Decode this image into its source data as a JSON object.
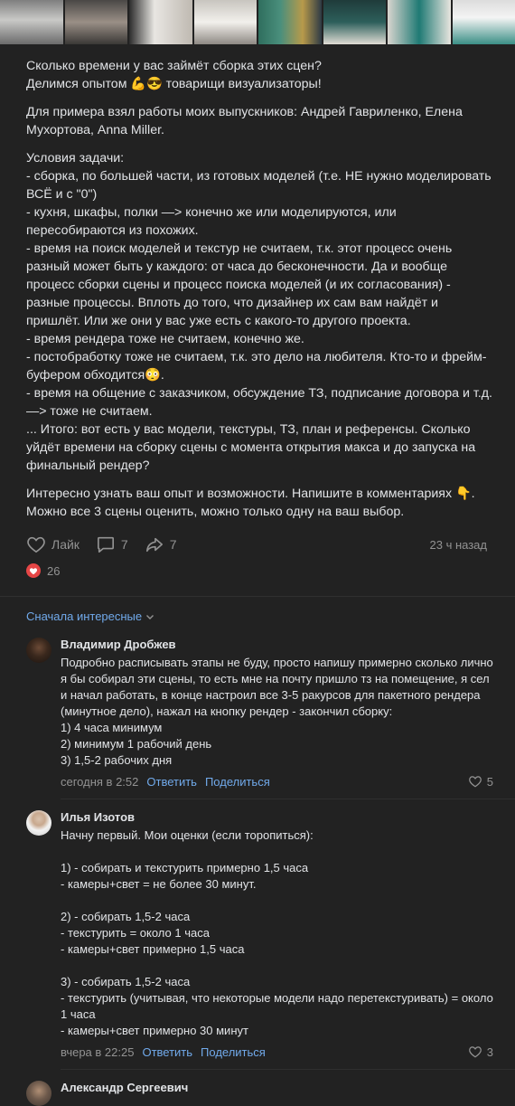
{
  "post": {
    "paragraphs": [
      "Сколько времени у вас займёт сборка этих сцен?\nДелимся опытом 💪😎 товарищи визуализаторы!",
      "Для примера взял работы моих выпускников: Андрей Гавриленко, Елена Мухортова, Anna Miller.",
      "Условия задачи:\n- сборка, по большей части, из готовых моделей (т.е. НЕ нужно моделировать ВСЁ и с \"0\")\n- кухня, шкафы, полки —> конечно же или моделируются, или пересобираются из похожих.\n- время на поиск моделей и текстур не считаем, т.к. этот процесс очень разный может быть у каждого: от часа до бесконечности. Да и вообще процесс сборки сцены и процесс поиска моделей (и их согласования) - разные процессы. Вплоть до того, что дизайнер их сам вам найдёт и пришлёт. Или же они у вас уже есть с какого-то другого проекта.\n- время рендера тоже не считаем, конечно же.\n- постобработку тоже не считаем, т.к. это дело на любителя. Кто-то и фрейм-буфером обходится😳.\n- время на общение с заказчиком, обсуждение ТЗ, подписание договора и т.д. —> тоже не считаем.\n... Итого: вот есть у вас модели, текстуры, ТЗ, план и референсы. Сколько уйдёт времени на сборку сцены с момента открытия макса и до запуска на финальный рендер?",
      "Интересно узнать ваш опыт и возможности. Напишите в комментариях 👇.\nМожно все 3 сцены оценить, можно только одну на ваш выбор."
    ],
    "like_label": "Лайк",
    "comments_count": "7",
    "shares_count": "7",
    "time": "23 ч назад",
    "likes_count": "26"
  },
  "sort_label": "Сначала интересные",
  "comments": [
    {
      "name": "Владимир Дробжев",
      "text": "Подробно расписывать этапы не буду, просто напишу примерно сколько лично я бы собирал эти сцены, то есть мне на почту пришло тз на помещение, я сел и начал работать, в конце настроил все 3-5 ракурсов для пакетного рендера (минутное дело), нажал на кнопку рендер - закончил сборку:\n1) 4 часа минимум\n2) минимум 1 рабочий день\n3) 1,5-2 рабочих дня",
      "time": "сегодня в 2:52",
      "reply": "Ответить",
      "share": "Поделиться",
      "likes": "5"
    },
    {
      "name": "Илья Изотов",
      "text": "Начну первый. Мои оценки (если торопиться):\n\n1) - собирать и текстурить примерно 1,5 часа\n- камеры+свет = не более 30 минут.\n\n2) - собирать 1,5-2 часа\n- текстурить = около 1 часа\n- камеры+свет примерно 1,5 часа\n\n3) - собирать 1,5-2 часа\n- текстурить (учитывая, что некоторые модели надо перетекстуривать) = около 1 часа\n- камеры+свет примерно 30 минут",
      "time": "вчера в 22:25",
      "reply": "Ответить",
      "share": "Поделиться",
      "likes": "3"
    },
    {
      "name": "Александр Сергеевич"
    }
  ],
  "colors": {
    "background": "#222222",
    "text": "#e1e3e6",
    "muted": "#939393",
    "link": "#71aaeb",
    "like_badge": "#e64646"
  }
}
